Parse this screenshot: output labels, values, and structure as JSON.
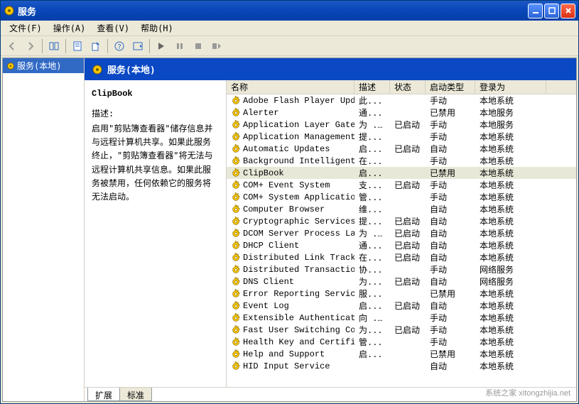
{
  "window": {
    "title": "服务"
  },
  "menubar": [
    {
      "label": "文件(F)"
    },
    {
      "label": "操作(A)"
    },
    {
      "label": "查看(V)"
    },
    {
      "label": "帮助(H)"
    }
  ],
  "tree": {
    "root": "服务(本地)"
  },
  "header": {
    "title": "服务(本地)"
  },
  "detail": {
    "title": "ClipBook",
    "desc_label": "描述:",
    "description": "启用\"剪贴簿查看器\"储存信息并与远程计算机共享。如果此服务终止，\"剪贴簿查看器\"将无法与远程计算机共享信息。如果此服务被禁用，任何依赖它的服务将无法启动。"
  },
  "columns": {
    "name": "名称",
    "desc": "描述",
    "state": "状态",
    "startup": "启动类型",
    "logon": "登录为"
  },
  "selected_index": 6,
  "services": [
    {
      "name": "Adobe Flash Player Updat...",
      "desc": "此...",
      "state": "",
      "startup": "手动",
      "logon": "本地系统"
    },
    {
      "name": "Alerter",
      "desc": "通...",
      "state": "",
      "startup": "已禁用",
      "logon": "本地服务"
    },
    {
      "name": "Application Layer Gatewa...",
      "desc": "为 ...",
      "state": "已启动",
      "startup": "手动",
      "logon": "本地服务"
    },
    {
      "name": "Application Management",
      "desc": "提...",
      "state": "",
      "startup": "手动",
      "logon": "本地系统"
    },
    {
      "name": "Automatic Updates",
      "desc": "启...",
      "state": "已启动",
      "startup": "自动",
      "logon": "本地系统"
    },
    {
      "name": "Background Intelligent T...",
      "desc": "在...",
      "state": "",
      "startup": "手动",
      "logon": "本地系统"
    },
    {
      "name": "ClipBook",
      "desc": "启...",
      "state": "",
      "startup": "已禁用",
      "logon": "本地系统"
    },
    {
      "name": "COM+ Event System",
      "desc": "支...",
      "state": "已启动",
      "startup": "手动",
      "logon": "本地系统"
    },
    {
      "name": "COM+ System Application",
      "desc": "管...",
      "state": "",
      "startup": "手动",
      "logon": "本地系统"
    },
    {
      "name": "Computer Browser",
      "desc": "维...",
      "state": "",
      "startup": "自动",
      "logon": "本地系统"
    },
    {
      "name": "Cryptographic Services",
      "desc": "提...",
      "state": "已启动",
      "startup": "自动",
      "logon": "本地系统"
    },
    {
      "name": "DCOM Server Process Laun...",
      "desc": "为 ...",
      "state": "已启动",
      "startup": "自动",
      "logon": "本地系统"
    },
    {
      "name": "DHCP Client",
      "desc": "通...",
      "state": "已启动",
      "startup": "自动",
      "logon": "本地系统"
    },
    {
      "name": "Distributed Link Trackin...",
      "desc": "在...",
      "state": "已启动",
      "startup": "自动",
      "logon": "本地系统"
    },
    {
      "name": "Distributed Transaction ...",
      "desc": "协...",
      "state": "",
      "startup": "手动",
      "logon": "网络服务"
    },
    {
      "name": "DNS Client",
      "desc": "为...",
      "state": "已启动",
      "startup": "自动",
      "logon": "网络服务"
    },
    {
      "name": "Error Reporting Service",
      "desc": "服...",
      "state": "",
      "startup": "已禁用",
      "logon": "本地系统"
    },
    {
      "name": "Event Log",
      "desc": "启...",
      "state": "已启动",
      "startup": "自动",
      "logon": "本地系统"
    },
    {
      "name": "Extensible Authenticatio...",
      "desc": "向 ...",
      "state": "",
      "startup": "手动",
      "logon": "本地系统"
    },
    {
      "name": "Fast User Switching Comp...",
      "desc": "为...",
      "state": "已启动",
      "startup": "手动",
      "logon": "本地系统"
    },
    {
      "name": "Health Key and Certifica...",
      "desc": "管...",
      "state": "",
      "startup": "手动",
      "logon": "本地系统"
    },
    {
      "name": "Help and Support",
      "desc": "启...",
      "state": "",
      "startup": "已禁用",
      "logon": "本地系统"
    },
    {
      "name": "HID Input Service",
      "desc": "",
      "state": "",
      "startup": "自动",
      "logon": "本地系统"
    }
  ],
  "tabs": {
    "extended": "扩展",
    "standard": "标准"
  },
  "watermark": "系统之家 xitongzhijia.net"
}
